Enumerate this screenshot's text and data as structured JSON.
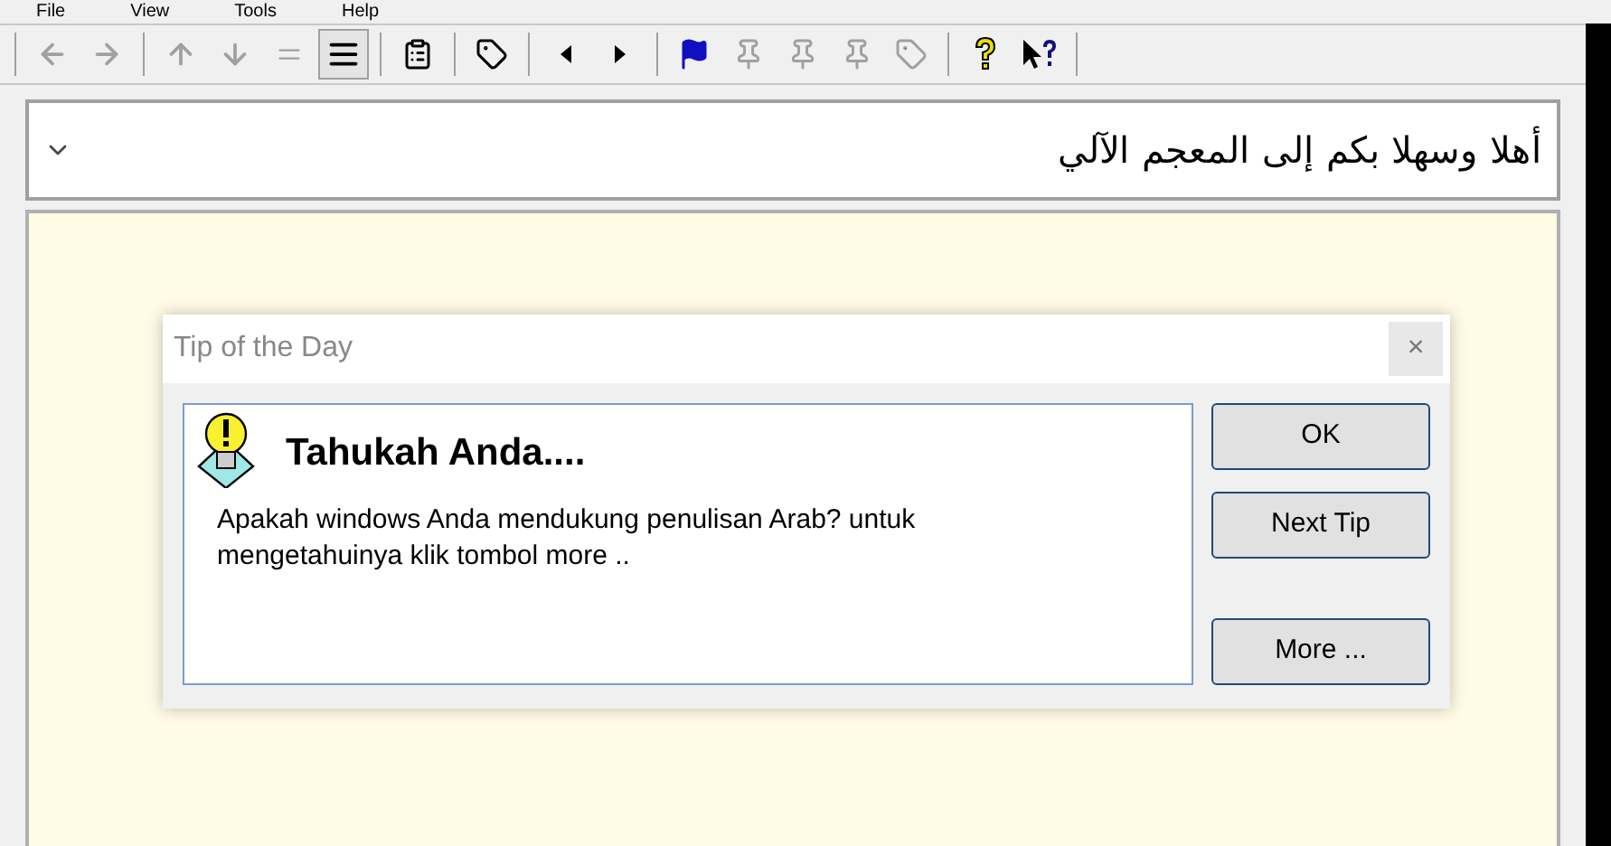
{
  "menu": [
    "File",
    "View",
    "Tools",
    "Help"
  ],
  "toolbar": [
    {
      "kind": "back",
      "disabled": true,
      "selected": false
    },
    {
      "kind": "forward",
      "disabled": true,
      "selected": false
    },
    {
      "kind": "sep"
    },
    {
      "kind": "up",
      "disabled": true,
      "selected": false
    },
    {
      "kind": "down",
      "disabled": true,
      "selected": false
    },
    {
      "kind": "thin-lines",
      "disabled": true,
      "selected": false
    },
    {
      "kind": "thick-lines",
      "disabled": false,
      "selected": true
    },
    {
      "kind": "sep"
    },
    {
      "kind": "properties",
      "disabled": false,
      "selected": false
    },
    {
      "kind": "sep"
    },
    {
      "kind": "tag",
      "disabled": false,
      "selected": false
    },
    {
      "kind": "sep"
    },
    {
      "kind": "prev",
      "disabled": false,
      "selected": false
    },
    {
      "kind": "next",
      "disabled": false,
      "selected": false
    },
    {
      "kind": "sep"
    },
    {
      "kind": "flag",
      "disabled": false,
      "selected": false
    },
    {
      "kind": "pin",
      "disabled": true,
      "selected": false
    },
    {
      "kind": "pin",
      "disabled": true,
      "selected": false
    },
    {
      "kind": "pin",
      "disabled": true,
      "selected": false
    },
    {
      "kind": "tag",
      "disabled": true,
      "selected": false
    },
    {
      "kind": "sep"
    },
    {
      "kind": "help",
      "disabled": false,
      "selected": false
    },
    {
      "kind": "context-help",
      "disabled": false,
      "selected": false
    },
    {
      "kind": "sep"
    }
  ],
  "combo": {
    "value": "أهلا وسهلا بكم إلى المعجم الآلي"
  },
  "dialog": {
    "title": "Tip of the Day",
    "close": "×",
    "heading": "Tahukah Anda....",
    "text": "Apakah windows Anda mendukung penulisan Arab? untuk mengetahuinya klik tombol more ..",
    "buttons": [
      "OK",
      "Next Tip",
      "More ..."
    ]
  }
}
